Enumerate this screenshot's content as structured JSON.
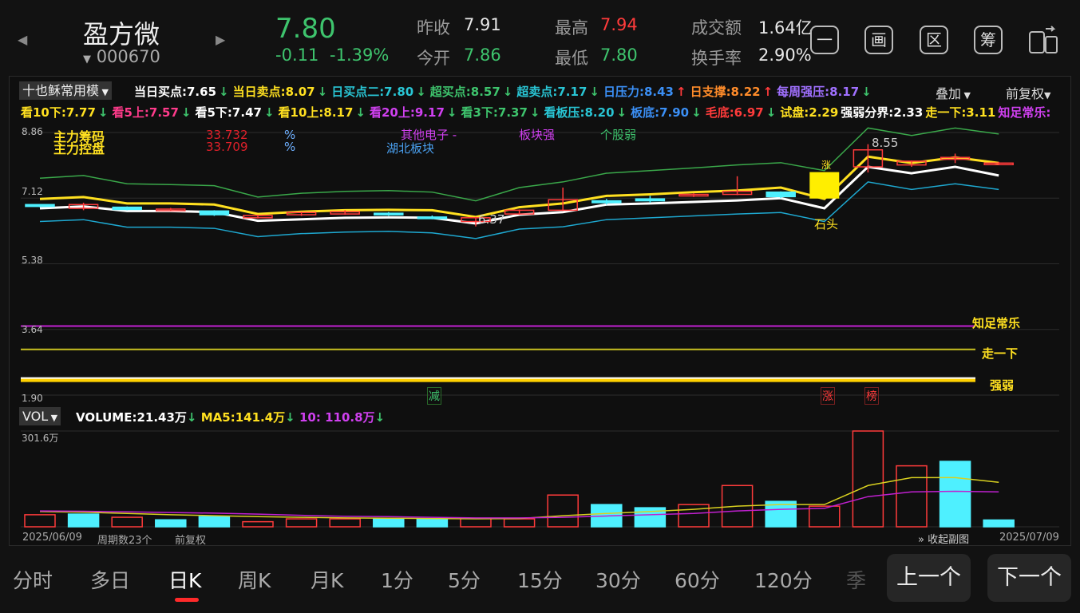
{
  "stock": {
    "name": "盈方微",
    "code": "000670",
    "price": "7.80",
    "change": "-0.11",
    "change_pct": "-1.39%"
  },
  "quote": {
    "prev_close_label": "昨收",
    "prev_close": "7.91",
    "open_label": "今开",
    "open": "7.86",
    "high_label": "最高",
    "high": "7.94",
    "low_label": "最低",
    "low": "7.80",
    "amount_label": "成交额",
    "amount": "1.64亿",
    "turnover_label": "换手率",
    "turnover": "2.90%"
  },
  "icons": [
    "minus-box-icon",
    "picture-box-icon",
    "zone-box-icon",
    "chip-box-icon",
    "switch-device-icon"
  ],
  "icon_glyphs": [
    "一",
    "画",
    "区",
    "筹"
  ],
  "indicator": {
    "name": "十也稣常用模",
    "overlay": "叠加",
    "adjust": "前复权"
  },
  "row1": [
    {
      "t": "当日买点:7.65",
      "c": "#ffffff",
      "a": "↓"
    },
    {
      "t": "当日卖点:8.07",
      "c": "#ffe020",
      "a": "↓"
    },
    {
      "t": "日买点二:7.80",
      "c": "#29c5d4",
      "a": "↓"
    },
    {
      "t": "超买点:8.57",
      "c": "#3ec46d",
      "a": "↓"
    },
    {
      "t": "超卖点:7.17",
      "c": "#29c5d4",
      "a": "↓"
    },
    {
      "t": "日压力:8.43",
      "c": "#3b8ff5",
      "a": "↑"
    },
    {
      "t": "日支撑:8.22",
      "c": "#ff8c2a",
      "a": "↑"
    },
    {
      "t": "每周强压:8.17",
      "c": "#a070ff",
      "a": "↓"
    }
  ],
  "row2": [
    {
      "t": "看10下:7.77",
      "c": "#ffe020",
      "a": "↓"
    },
    {
      "t": "看5上:7.57",
      "c": "#ff3b8b",
      "a": "↓"
    },
    {
      "t": "看5下:7.47",
      "c": "#ffffff",
      "a": "↓"
    },
    {
      "t": "看10上:8.17",
      "c": "#ffe020",
      "a": "↓"
    },
    {
      "t": "看20上:9.17",
      "c": "#d040f0",
      "a": "↓"
    },
    {
      "t": "看3下:7.37",
      "c": "#3ec46d",
      "a": "↓"
    },
    {
      "t": "看板压:8.20",
      "c": "#29c5d4",
      "a": "↓"
    },
    {
      "t": "板底:7.90",
      "c": "#3b8ff5",
      "a": "↓"
    },
    {
      "t": "毛底:6.97",
      "c": "#ff3b3b",
      "a": "↓"
    },
    {
      "t": "试盘:2.29",
      "c": "#ffe020",
      "a": ""
    },
    {
      "t": "强弱分界:2.33",
      "c": "#ffffff",
      "a": ""
    },
    {
      "t": "走一下:3.11",
      "c": "#ffe020",
      "a": ""
    },
    {
      "t": "知足常乐:",
      "c": "#d040f0",
      "a": ""
    }
  ],
  "annot": {
    "chips_label": "主力筹码",
    "chips_value": "33.732",
    "control_label": "主力控盘",
    "control_value": "33.709",
    "pct": "%",
    "sector": "其他电子 -",
    "sector2": "湖北板块",
    "sector_strong": "板块强",
    "stock_weak": "个股弱",
    "high_mark": "8.55",
    "low_mark": "6.37",
    "stone": "石头",
    "up_mark": "涨",
    "zhizu": "知足常乐",
    "zouyixia": "走一下",
    "qiangruo": "强弱",
    "jian": "减",
    "zhang": "涨",
    "bang": "榜"
  },
  "axis": {
    "y1": "8.86",
    "y2": "7.12",
    "y3": "5.38",
    "y4": "3.64",
    "y5": "1.90",
    "vol_max": "301.6万"
  },
  "vol": {
    "label": "VOL",
    "volume": "VOLUME:21.43万",
    "ma5": "MA5:141.4万",
    "ma10": "10: 110.8万",
    "arrow": "↓"
  },
  "footer": {
    "start": "2025/06/09",
    "periods": "周期数23个",
    "adj": "前复权",
    "collapse": "收起副图",
    "end": "2025/07/09"
  },
  "tabs": [
    "分时",
    "多日",
    "日K",
    "周K",
    "月K",
    "1分",
    "5分",
    "15分",
    "30分",
    "60分",
    "120分",
    "季"
  ],
  "active_tab": "日K",
  "buttons": {
    "prev": "上一个",
    "next": "下一个"
  },
  "chart_data": {
    "type": "candlestick",
    "x_range": [
      "2025/06/09",
      "2025/07/09"
    ],
    "periods": 23,
    "y_range": [
      1.9,
      8.86
    ],
    "high": 8.55,
    "low": 6.37,
    "candles": [
      {
        "o": 6.95,
        "c": 6.9,
        "h": 6.95,
        "l": 6.88
      },
      {
        "o": 6.85,
        "c": 6.95,
        "h": 7.0,
        "l": 6.8
      },
      {
        "o": 6.88,
        "c": 6.82,
        "h": 6.9,
        "l": 6.8
      },
      {
        "o": 6.8,
        "c": 6.83,
        "h": 6.86,
        "l": 6.78
      },
      {
        "o": 6.78,
        "c": 6.68,
        "h": 6.8,
        "l": 6.65
      },
      {
        "o": 6.6,
        "c": 6.66,
        "h": 6.68,
        "l": 6.58
      },
      {
        "o": 6.68,
        "c": 6.74,
        "h": 6.76,
        "l": 6.65
      },
      {
        "o": 6.7,
        "c": 6.76,
        "h": 6.8,
        "l": 6.68
      },
      {
        "o": 6.72,
        "c": 6.7,
        "h": 6.75,
        "l": 6.65
      },
      {
        "o": 6.62,
        "c": 6.59,
        "h": 6.66,
        "l": 6.56
      },
      {
        "o": 6.5,
        "c": 6.6,
        "h": 6.62,
        "l": 6.37
      },
      {
        "o": 6.7,
        "c": 6.8,
        "h": 6.82,
        "l": 6.68
      },
      {
        "o": 6.8,
        "c": 7.08,
        "h": 7.4,
        "l": 6.78
      },
      {
        "o": 7.05,
        "c": 7.0,
        "h": 7.1,
        "l": 6.95
      },
      {
        "o": 7.1,
        "c": 7.05,
        "h": 7.18,
        "l": 7.0
      },
      {
        "o": 7.18,
        "c": 7.22,
        "h": 7.25,
        "l": 7.15
      },
      {
        "o": 7.22,
        "c": 7.3,
        "h": 7.7,
        "l": 7.2
      },
      {
        "o": 7.28,
        "c": 7.16,
        "h": 7.3,
        "l": 7.12
      },
      {
        "o": 7.12,
        "c": 7.8,
        "h": 7.8,
        "l": 7.12
      },
      {
        "o": 7.95,
        "c": 8.4,
        "h": 8.55,
        "l": 7.8
      },
      {
        "o": 8.0,
        "c": 8.1,
        "h": 8.12,
        "l": 7.95
      },
      {
        "o": 8.15,
        "c": 8.2,
        "h": 8.3,
        "l": 8.05
      },
      {
        "o": 8.05,
        "c": 8.05,
        "h": 8.08,
        "l": 8.0
      }
    ],
    "lines": {
      "white": [
        6.85,
        6.9,
        6.78,
        6.78,
        6.75,
        6.52,
        6.56,
        6.6,
        6.61,
        6.6,
        6.45,
        6.68,
        6.75,
        6.95,
        6.98,
        7.02,
        7.06,
        7.12,
        6.85,
        7.95,
        7.78,
        7.95,
        7.72
      ],
      "yellow": [
        7.1,
        7.15,
        6.98,
        6.98,
        6.95,
        6.7,
        6.76,
        6.8,
        6.81,
        6.8,
        6.62,
        6.88,
        6.98,
        7.18,
        7.22,
        7.28,
        7.32,
        7.4,
        7.1,
        8.22,
        8.05,
        8.2,
        8.05
      ],
      "green": [
        7.65,
        7.72,
        7.5,
        7.48,
        7.45,
        7.15,
        7.25,
        7.3,
        7.32,
        7.28,
        7.05,
        7.4,
        7.55,
        7.78,
        7.85,
        7.92,
        8.0,
        8.06,
        7.85,
        8.98,
        8.78,
        8.98,
        8.82
      ],
      "cyan": [
        6.5,
        6.55,
        6.35,
        6.35,
        6.32,
        6.1,
        6.18,
        6.22,
        6.24,
        6.2,
        6.05,
        6.3,
        6.36,
        6.55,
        6.6,
        6.65,
        6.7,
        6.74,
        6.5,
        7.55,
        7.35,
        7.5,
        7.35
      ]
    },
    "flat_lines": [
      {
        "name": "知足常乐",
        "v": 3.73,
        "c": "#c020d0"
      },
      {
        "name": "走一下",
        "v": 3.11,
        "c": "#c8c020"
      },
      {
        "name": "强弱",
        "v": 2.33,
        "c": "#ffffff"
      },
      {
        "name": "试盘",
        "v": 2.29,
        "c": "#ffd000"
      }
    ],
    "volume": {
      "max": 301.6,
      "unit": "万",
      "values": [
        38,
        40,
        30,
        22,
        32,
        16,
        25,
        25,
        25,
        25,
        26,
        25,
        100,
        70,
        60,
        70,
        130,
        80,
        65,
        301.6,
        192,
        206,
        21.43
      ],
      "up": [
        true,
        false,
        true,
        false,
        false,
        true,
        true,
        true,
        false,
        false,
        true,
        true,
        true,
        false,
        false,
        true,
        true,
        false,
        true,
        true,
        true,
        false,
        false
      ],
      "ma5": [
        48,
        46,
        42,
        38,
        35,
        32,
        30,
        28,
        27,
        26,
        25,
        26,
        35,
        42,
        48,
        55,
        65,
        70,
        70,
        130,
        155,
        155,
        140
      ],
      "ma10": [
        50,
        49,
        47,
        45,
        43,
        40,
        36,
        33,
        32,
        30,
        28,
        28,
        30,
        34,
        38,
        42,
        50,
        55,
        58,
        95,
        110,
        112,
        110
      ]
    }
  }
}
